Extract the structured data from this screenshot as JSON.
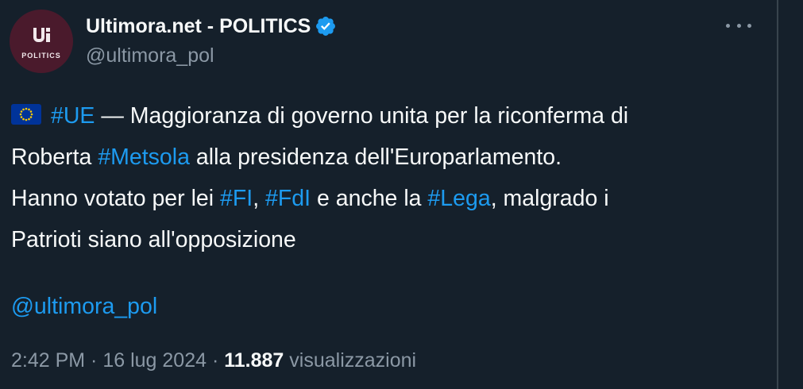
{
  "author": {
    "avatar_label": "POLITICS",
    "display_name": "Ultimora.net - POLITICS",
    "handle": "@ultimora_pol",
    "verified": true,
    "verified_color": "#1d9bf0"
  },
  "menu": {
    "more_icon": "more-horizontal-icon"
  },
  "tweet": {
    "flag_icon": "eu-flag-icon",
    "line1": {
      "tag_ue": "#UE",
      "text_a": " — Maggioranza di governo unita per la riconferma di"
    },
    "line2": {
      "text_a": "Roberta ",
      "tag_metsola": "#Metsola",
      "text_b": " alla presidenza dell'Europarlamento."
    },
    "line3": {
      "text_a": "Hanno votato per lei ",
      "tag_fi": "#FI",
      "text_b": ", ",
      "tag_fdi": "#FdI",
      "text_c": " e anche la ",
      "tag_lega": "#Lega",
      "text_d": ", malgrado i"
    },
    "line4": {
      "text_a": "Patrioti siano all'opposizione"
    },
    "mention": "@ultimora_pol"
  },
  "meta": {
    "time": "2:42 PM",
    "separator1": " · ",
    "date": "16 lug 2024",
    "separator2": " · ",
    "views_count": "11.887",
    "views_label": " visualizzazioni"
  },
  "colors": {
    "background": "#15202b",
    "text": "#f7f9f9",
    "muted": "#8b98a5",
    "link": "#1d9bf0"
  }
}
